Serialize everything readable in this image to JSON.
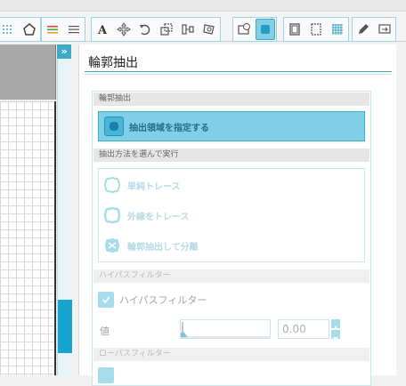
{
  "panel": {
    "title": "輪郭抽出",
    "section_extract": "輪郭抽出",
    "extract_button": "抽出領域を指定する",
    "section_method": "抽出方法を選んで実行",
    "options": [
      "単純トレース",
      "外線をトレース",
      "輪郭抽出して分離"
    ],
    "section_highpass": "ハイパスフィルター",
    "highpass_checkbox_label": "ハイパスフィルター",
    "value_label": "値",
    "value": "0.00",
    "section_lowpass": "ローパスフィルター"
  },
  "colors": {
    "accent": "#3fa9c9",
    "button_fill": "#7fd0e6",
    "scroll_thumb": "#16a5d0"
  },
  "toolbar_icons": [
    "grid-dots-icon",
    "pentagon-icon",
    "color-lines-icon",
    "lines-icon",
    "text-icon",
    "move-icon",
    "rotate-icon",
    "scale-icon",
    "align-icon",
    "distort-icon",
    "clock-image-icon",
    "contour-extract-icon",
    "page-icon",
    "frame-icon",
    "grid-icon",
    "pen-icon",
    "export-icon"
  ]
}
